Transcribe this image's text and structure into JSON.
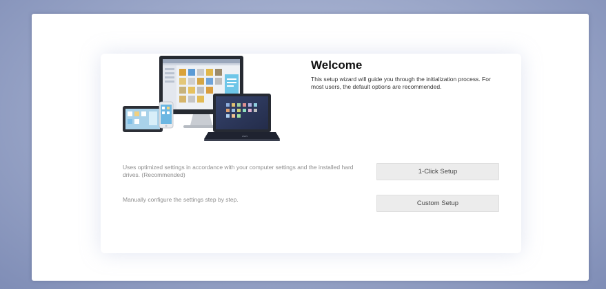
{
  "welcome": {
    "title": "Welcome",
    "description": "This setup wizard will guide you through the initialization process. For most users, the default options are recommended."
  },
  "options": [
    {
      "description": "Uses optimized settings in accordance with your computer settings and the installed hard drives. (Recommended)",
      "button_label": "1-Click Setup"
    },
    {
      "description": "Manually configure the settings step by step.",
      "button_label": "Custom Setup"
    }
  ],
  "illustration": {
    "icon": "devices-illustration-icon",
    "laptop_brand": "ASUS"
  },
  "colors": {
    "button_bg": "#ececec",
    "background": "#9aa6c8",
    "muted_text": "#8d8d8d"
  }
}
